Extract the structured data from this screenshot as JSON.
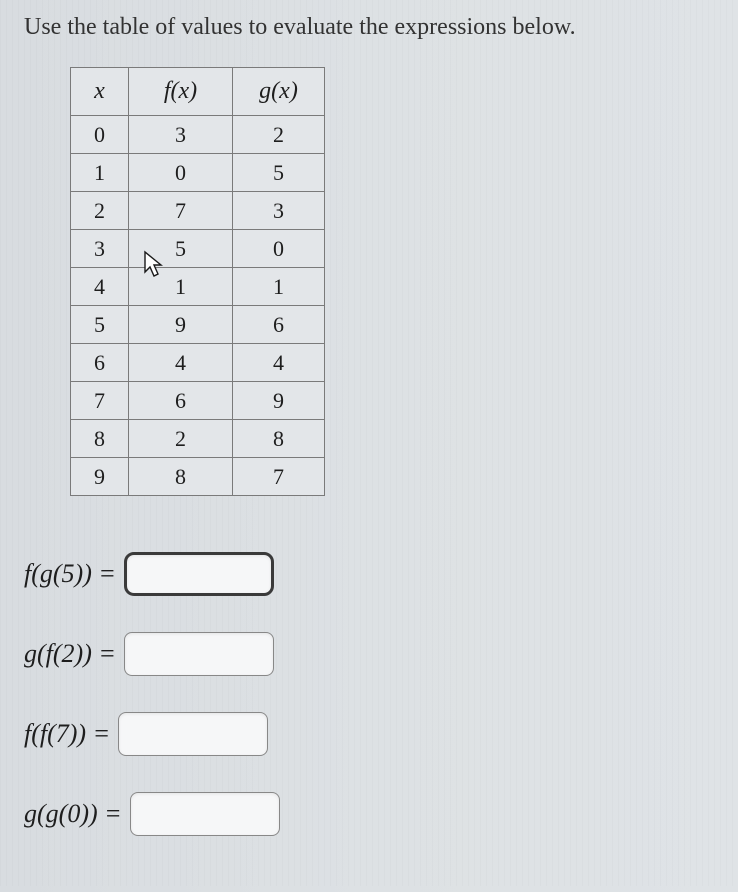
{
  "instruction": "Use the table of values to evaluate the expressions below.",
  "table": {
    "headers": {
      "x": "x",
      "fx": "f(x)",
      "gx": "g(x)"
    },
    "rows": [
      {
        "x": "0",
        "fx": "3",
        "gx": "2"
      },
      {
        "x": "1",
        "fx": "0",
        "gx": "5"
      },
      {
        "x": "2",
        "fx": "7",
        "gx": "3"
      },
      {
        "x": "3",
        "fx": "5",
        "gx": "0"
      },
      {
        "x": "4",
        "fx": "1",
        "gx": "1"
      },
      {
        "x": "5",
        "fx": "9",
        "gx": "6"
      },
      {
        "x": "6",
        "fx": "4",
        "gx": "4"
      },
      {
        "x": "7",
        "fx": "6",
        "gx": "9"
      },
      {
        "x": "8",
        "fx": "2",
        "gx": "8"
      },
      {
        "x": "9",
        "fx": "8",
        "gx": "7"
      }
    ]
  },
  "expressions": [
    {
      "label": "f(g(5)) =",
      "value": "",
      "focused": true
    },
    {
      "label": "g(f(2)) =",
      "value": "",
      "focused": false
    },
    {
      "label": "f(f(7)) =",
      "value": "",
      "focused": false
    },
    {
      "label": "g(g(0)) =",
      "value": "",
      "focused": false
    }
  ],
  "cursor_icon": "arrow-cursor"
}
